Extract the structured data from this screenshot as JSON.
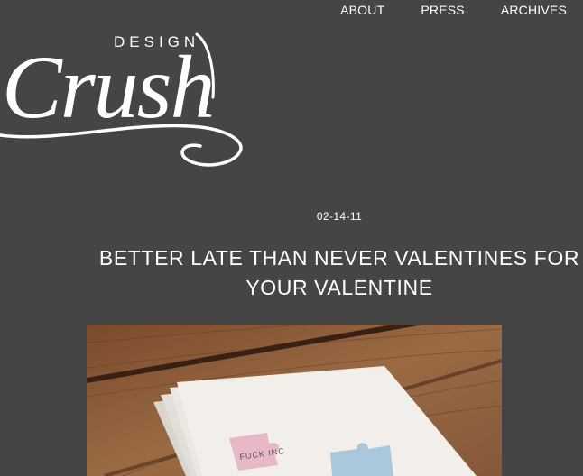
{
  "logo": {
    "line1": "DESIGN",
    "line2": "Crush"
  },
  "nav": {
    "items": [
      {
        "label": "ABOUT"
      },
      {
        "label": "PRESS"
      },
      {
        "label": "ARCHIVES"
      }
    ]
  },
  "post": {
    "date": "02-14-11",
    "title_line1": "BETTER LATE THAN NEVER VALENTINES FOR",
    "title_line2": "YOUR VALENTINE"
  },
  "image_text": {
    "card_text": "FUCK INC"
  },
  "colors": {
    "background": "#454545",
    "text": "#ffffff",
    "wood": "#8a5a38",
    "card": "#e9e6e1",
    "puzzle_pink": "#e7b8c6",
    "puzzle_blue": "#a9c8dc"
  }
}
